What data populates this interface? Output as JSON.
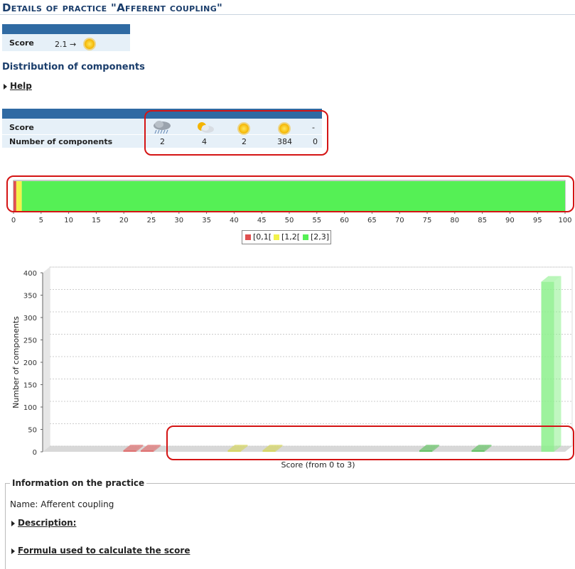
{
  "page": {
    "title": "Details of practice \"Afferent coupling\"",
    "score_label": "Score",
    "score_value": "2.1 →",
    "section_title": "Distribution of components",
    "help_link": "Help"
  },
  "distribution_table": {
    "row_score_label": "Score",
    "row_count_label": "Number of components",
    "columns": [
      {
        "icon": "rain-cloud-icon",
        "count": "2"
      },
      {
        "icon": "sun-cloud-icon",
        "count": "4"
      },
      {
        "icon": "sun-icon",
        "count": "2"
      },
      {
        "icon": "sun-icon",
        "count": "384"
      },
      {
        "icon": "",
        "score_text": "-",
        "count": "0"
      }
    ]
  },
  "stacked_bar": {
    "type": "bar",
    "stacked": true,
    "orientation": "horizontal",
    "xlim": [
      0,
      100
    ],
    "ticks": [
      "0",
      "5",
      "10",
      "15",
      "20",
      "25",
      "30",
      "35",
      "40",
      "45",
      "50",
      "55",
      "60",
      "65",
      "70",
      "75",
      "80",
      "85",
      "90",
      "95",
      "100"
    ],
    "segments": [
      {
        "name": "[0,1[",
        "value": 0.5,
        "color": "#e05050"
      },
      {
        "name": "[1,2[",
        "value": 1.0,
        "color": "#f2f24a"
      },
      {
        "name": "[2,3]",
        "value": 98.5,
        "color": "#55f055"
      }
    ]
  },
  "legend": [
    "[0,1[",
    "[1,2[",
    "[2,3]"
  ],
  "chart_data": {
    "type": "bar",
    "xlabel": "Score (from 0 to 3)",
    "ylabel": "Number of components",
    "ylim": [
      0,
      400
    ],
    "yticks": [
      "0",
      "50",
      "100",
      "150",
      "200",
      "250",
      "300",
      "350",
      "400"
    ],
    "bars": [
      {
        "bin": 0.5,
        "value": 2,
        "color": "#e06060"
      },
      {
        "bin": 0.6,
        "value": 2,
        "color": "#e06060"
      },
      {
        "bin": 1.1,
        "value": 2,
        "color": "#d6d650"
      },
      {
        "bin": 1.3,
        "value": 2,
        "color": "#d6d650"
      },
      {
        "bin": 2.2,
        "value": 2,
        "color": "#55c055"
      },
      {
        "bin": 2.5,
        "value": 2,
        "color": "#55c055"
      },
      {
        "bin": 2.9,
        "value": 380,
        "color": "#8cf08c"
      }
    ],
    "colors": {
      "red": "#e06060",
      "yellow": "#d6d650",
      "green": "#55c055",
      "highlight": "#d41414"
    }
  },
  "info": {
    "legend": "Information on the practice",
    "name_text": "Name: Afferent coupling",
    "description_link": "Description:",
    "formula_link": "Formula used to calculate the score"
  }
}
